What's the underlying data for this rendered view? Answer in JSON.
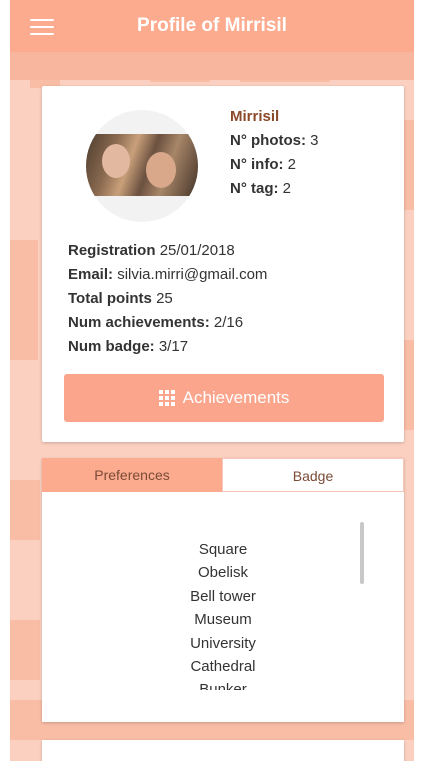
{
  "header": {
    "title": "Profile of Mirrisil"
  },
  "profile": {
    "name": "Mirrisil",
    "photos_label": "N° photos:",
    "photos_value": "3",
    "info_label": "N° info:",
    "info_value": "2",
    "tag_label": "N° tag:",
    "tag_value": "2",
    "registration_label": "Registration",
    "registration_value": "25/01/2018",
    "email_label": "Email:",
    "email_value": "silvia.mirri@gmail.com",
    "points_label": "Total points",
    "points_value": "25",
    "achievements_label": "Num achievements:",
    "achievements_value": "2/16",
    "badge_label": "Num badge:",
    "badge_value": "3/17"
  },
  "buttons": {
    "achievements": "Achievements"
  },
  "tabs": [
    {
      "label": "Preferences"
    },
    {
      "label": "Badge"
    }
  ],
  "preferences": [
    "Square",
    "Obelisk",
    "Bell tower",
    "Museum",
    "University",
    "Cathedral",
    "Bunker"
  ],
  "colors": {
    "primary": "#fcab8f",
    "button": "#fba58c",
    "name": "#8b4a2a",
    "background": "#fbd0c0"
  }
}
